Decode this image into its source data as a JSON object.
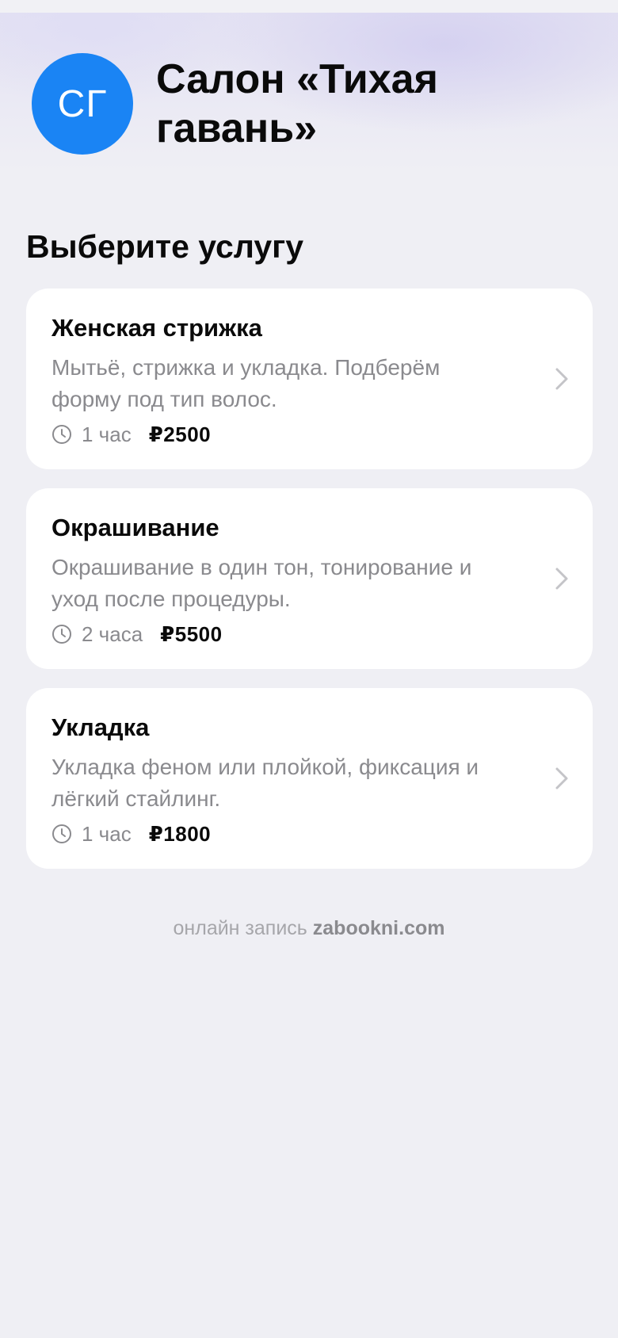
{
  "salon": {
    "initials": "СГ",
    "name": "Салон «Тихая гавань»",
    "avatar_color": "#1a84f4"
  },
  "section_title": "Выберите услугу",
  "services": [
    {
      "title": "Женская стрижка",
      "description": "Мытьё, стрижка и укладка. Подберём форму под тип волос.",
      "duration": "1 час",
      "price": "₽2500",
      "icon": "clock-icon"
    },
    {
      "title": "Окрашивание",
      "description": "Окрашивание в один тон, тонирование и уход после процедуры.",
      "duration": "2 часа",
      "price": "₽5500",
      "icon": "clock-icon"
    },
    {
      "title": "Укладка",
      "description": "Укладка феном или плойкой, фиксация и лёгкий стайлинг.",
      "duration": "1 час",
      "price": "₽1800",
      "icon": "clock-icon"
    }
  ],
  "footer": {
    "prefix": "онлайн запись",
    "brand": "zabookni.com"
  }
}
